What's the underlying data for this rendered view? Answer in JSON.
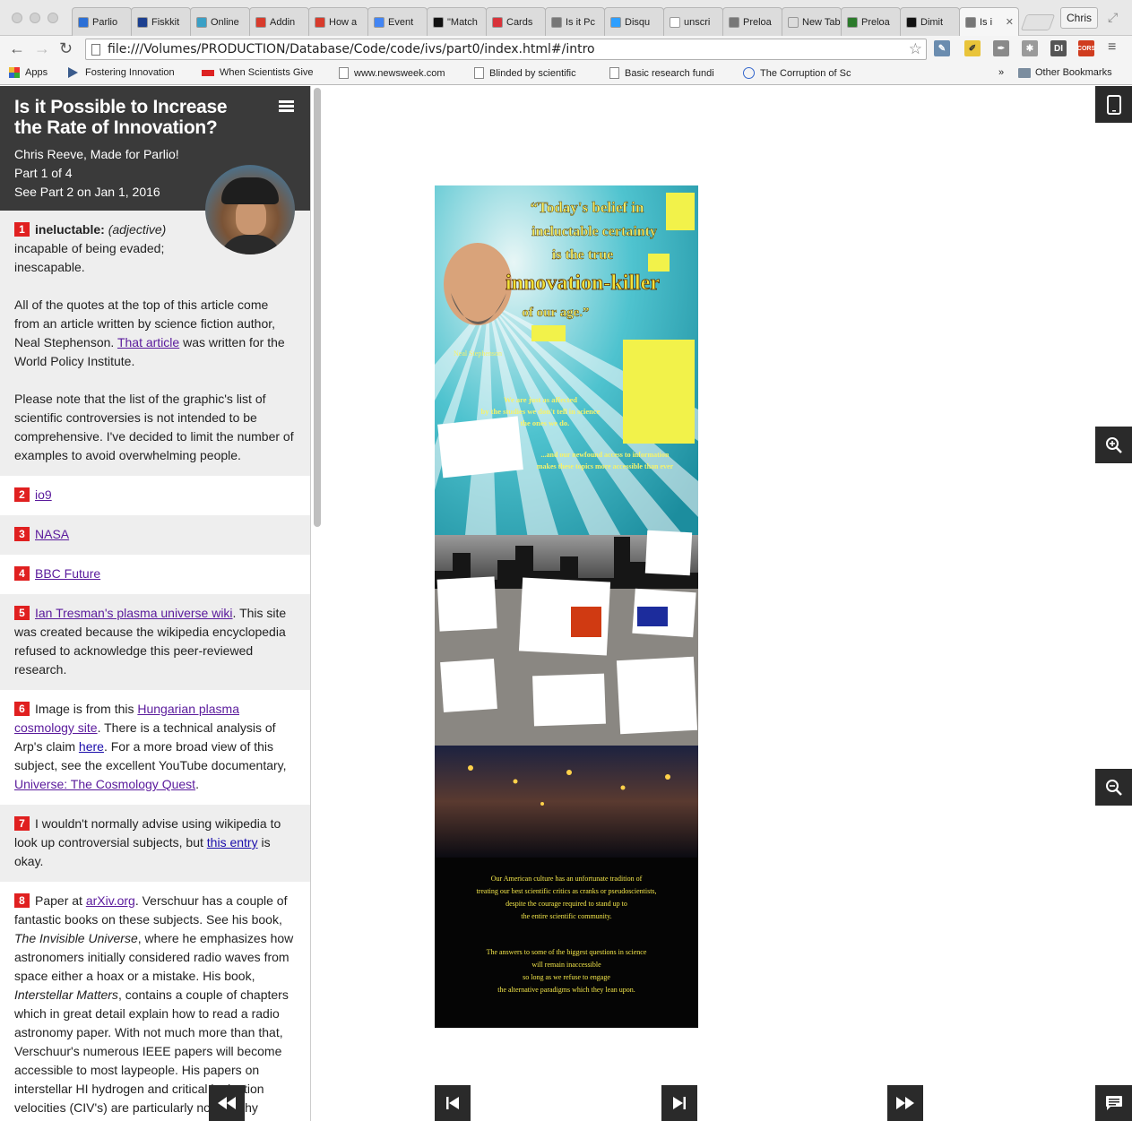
{
  "browser": {
    "profile": "Chris",
    "url": "file:///Volumes/PRODUCTION/Database/Code/code/ivs/part0/index.html#/intro",
    "tabs": [
      {
        "label": "Parlio",
        "color": "#2b6fd6"
      },
      {
        "label": "Fiskkit",
        "color": "#1c3f8f"
      },
      {
        "label": "Online",
        "color": "#3aa0c6"
      },
      {
        "label": "Addin",
        "color": "#d83b2c"
      },
      {
        "label": "How a",
        "color": "#d83b2c"
      },
      {
        "label": "Event",
        "color": "#4285f4"
      },
      {
        "label": "\"Match",
        "color": "#111111"
      },
      {
        "label": "Cards",
        "color": "#d8333a"
      },
      {
        "label": "Is it Pc",
        "color": "#777777"
      },
      {
        "label": "Disqu",
        "color": "#2e9fff"
      },
      {
        "label": "unscri",
        "color": "#ffffff"
      },
      {
        "label": "Preloa",
        "color": "#777777"
      },
      {
        "label": "New Tab",
        "color": "#dcdcdc"
      },
      {
        "label": "Preloa",
        "color": "#2b7a2b"
      },
      {
        "label": "Dimit",
        "color": "#111111"
      },
      {
        "label": "Is i",
        "color": "#777777"
      }
    ],
    "bookmarks": [
      {
        "label": "Apps"
      },
      {
        "label": "Fostering Innovation"
      },
      {
        "label": "When Scientists Give"
      },
      {
        "label": "www.newsweek.com"
      },
      {
        "label": "Blinded by scientific"
      },
      {
        "label": "Basic research fundi"
      },
      {
        "label": "The Corruption of Sc"
      },
      {
        "label": "Other Bookmarks"
      }
    ],
    "extensions": [
      {
        "label": "DI",
        "color": "#555555"
      },
      {
        "label": "CORS",
        "color": "#d03c1f"
      }
    ]
  },
  "sidebar": {
    "title": "Is it Possible to Increase the Rate of Innovation?",
    "author": "Chris Reeve, Made for Parlio!",
    "part": "Part 1 of 4",
    "next": "See Part 2 on Jan 1, 2016",
    "notes": [
      {
        "n": "1",
        "term": "ineluctable:",
        "pos": "(adjective)",
        "def": "incapable of being evaded; inescapable.",
        "p2a": "All of the quotes at the top of this article come from an article written by science fiction author, Neal Stephenson. ",
        "p2link": "That article",
        "p2b": " was written for the World Policy Institute.",
        "p3": "Please note that the list of the graphic's list of scientific controversies is not intended to be comprehensive. I've decided to limit the number of examples to avoid overwhelming people."
      },
      {
        "n": "2",
        "link": "io9"
      },
      {
        "n": "3",
        "link": "NASA"
      },
      {
        "n": "4",
        "link": "BBC Future"
      },
      {
        "n": "5",
        "link": "Ian Tresman's plasma universe wiki",
        "text": ". This site was created because the wikipedia encyclopedia refused to acknowledge this peer-reviewed research."
      },
      {
        "n": "6",
        "a": "Image is from this ",
        "link": "Hungarian plasma cosmology site",
        "b": ". There is a technical analysis of Arp's claim ",
        "link2": "here",
        "c": ". For a more broad view of this subject, see the excellent YouTube documentary, ",
        "link3": "Universe: The Cosmology Quest",
        "d": "."
      },
      {
        "n": "7",
        "a": "I wouldn't normally advise using wikipedia to look up controversial subjects, but ",
        "link": "this entry",
        "b": " is okay."
      },
      {
        "n": "8",
        "a": "Paper at ",
        "link": "arXiv.org",
        "b": ". Verschuur has a couple of fantastic books on these subjects. See his book, ",
        "book1": "The Invisible Universe",
        "c": ", where he emphasizes how astronomers initially considered radio waves from space either a hoax or a mistake. His book, ",
        "book2": "Interstellar Matters",
        "d": ", contains a couple of chapters which in great detail explain how to read a radio astronomy paper. With not much more than that, Verschuur's numerous IEEE papers will become accessible to most laypeople. His papers on interstellar HI hydrogen and critical ionization velocities (CIV's) are particularly noteworthy because they appear to suggest that ionization is"
      }
    ]
  },
  "poster": {
    "quote_lines": [
      "“Today's belief in",
      "ineluctable certainty",
      "is the true",
      "innovation-killer",
      "of our age.”"
    ],
    "attribution": "Neal Stephenson",
    "mid_lines": [
      "We are just as affected",
      "by the studies we don't tell in science",
      "as the ones we do."
    ],
    "mid2_lines": [
      "...and our newfound access to information",
      "makes these topics more accessible than ever"
    ],
    "bottom_lines": [
      "Our American culture has an unfortunate tradition of",
      "treating our best scientific critics as cranks or pseudoscientists,",
      "despite the courage required to stand up to",
      "the entire scientific community.",
      "",
      "The answers to some of the biggest questions in science",
      "will remain inaccessible",
      "so long as we refuse to engage",
      "the alternative paradigms which they lean upon."
    ]
  },
  "controls": {
    "mobile_icon": "mobile-phone-icon",
    "zoom_in_icon": "zoom-in-icon",
    "zoom_out_icon": "zoom-out-icon",
    "rewind_icon": "rewind-icon",
    "first_icon": "skip-to-start-icon",
    "last_icon": "skip-to-end-icon",
    "forward_icon": "fast-forward-icon",
    "comments_icon": "comment-icon"
  }
}
